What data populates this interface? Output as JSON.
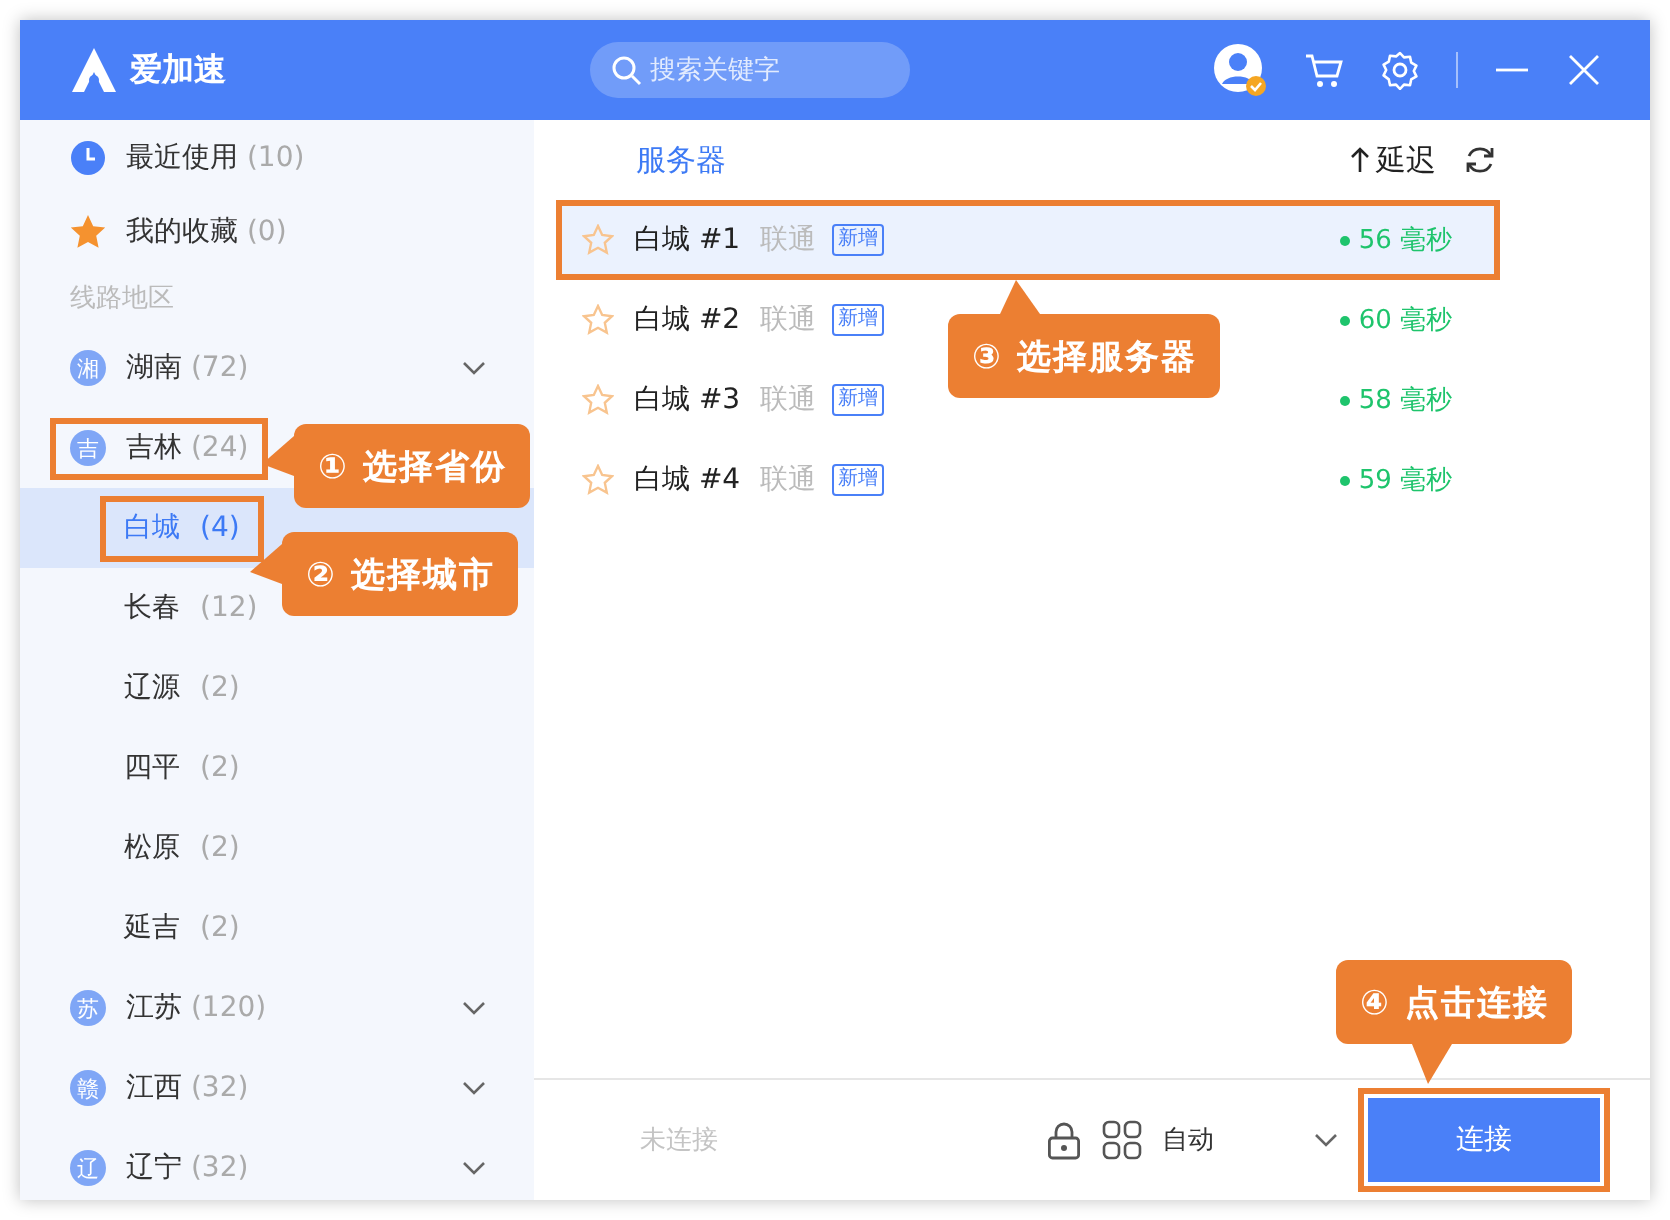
{
  "window": {
    "app_name": "爱加速"
  },
  "search": {
    "placeholder": "搜索关键字"
  },
  "sidebar": {
    "quick": [
      {
        "kind": "recent",
        "label": "最近使用",
        "count": "(10)"
      },
      {
        "kind": "favorites",
        "label": "我的收藏",
        "count": "(0)"
      }
    ],
    "section_label": "线路地区",
    "regions": [
      {
        "badge": "湘",
        "name": "湖南",
        "count": "(72)",
        "expanded": false,
        "selected": false,
        "highlighted": false
      },
      {
        "badge": "吉",
        "name": "吉林",
        "count": "(24)",
        "expanded": true,
        "selected": false,
        "highlighted": true,
        "children": [
          {
            "name": "白城",
            "count": "(4)",
            "selected": true,
            "highlighted": true
          },
          {
            "name": "长春",
            "count": "(12)",
            "selected": false,
            "highlighted": false
          },
          {
            "name": "辽源",
            "count": "(2)",
            "selected": false,
            "highlighted": false
          },
          {
            "name": "四平",
            "count": "(2)",
            "selected": false,
            "highlighted": false
          },
          {
            "name": "松原",
            "count": "(2)",
            "selected": false,
            "highlighted": false
          },
          {
            "name": "延吉",
            "count": "(2)",
            "selected": false,
            "highlighted": false
          }
        ]
      },
      {
        "badge": "苏",
        "name": "江苏",
        "count": "(120)",
        "expanded": false,
        "selected": false,
        "highlighted": false
      },
      {
        "badge": "赣",
        "name": "江西",
        "count": "(32)",
        "expanded": false,
        "selected": false,
        "highlighted": false
      },
      {
        "badge": "辽",
        "name": "辽宁",
        "count": "(32)",
        "expanded": false,
        "selected": false,
        "highlighted": false
      }
    ]
  },
  "servers": {
    "header": "服务器",
    "sort_label": "延迟",
    "rows": [
      {
        "name": "白城 #1",
        "isp": "联通",
        "tag": "新增",
        "latency": "56 毫秒",
        "selected": true,
        "highlighted": true
      },
      {
        "name": "白城 #2",
        "isp": "联通",
        "tag": "新增",
        "latency": "60 毫秒",
        "selected": false,
        "highlighted": false
      },
      {
        "name": "白城 #3",
        "isp": "联通",
        "tag": "新增",
        "latency": "58 毫秒",
        "selected": false,
        "highlighted": false
      },
      {
        "name": "白城 #4",
        "isp": "联通",
        "tag": "新增",
        "latency": "59 毫秒",
        "selected": false,
        "highlighted": false
      }
    ]
  },
  "footer": {
    "status": "未连接",
    "mode": "自动",
    "connect_button": {
      "label": "连接",
      "highlighted": true
    }
  },
  "annotations": [
    {
      "text": "① 选择省份"
    },
    {
      "text": "② 选择城市"
    },
    {
      "text": "③ 选择服务器"
    },
    {
      "text": "④ 点击连接"
    }
  ]
}
